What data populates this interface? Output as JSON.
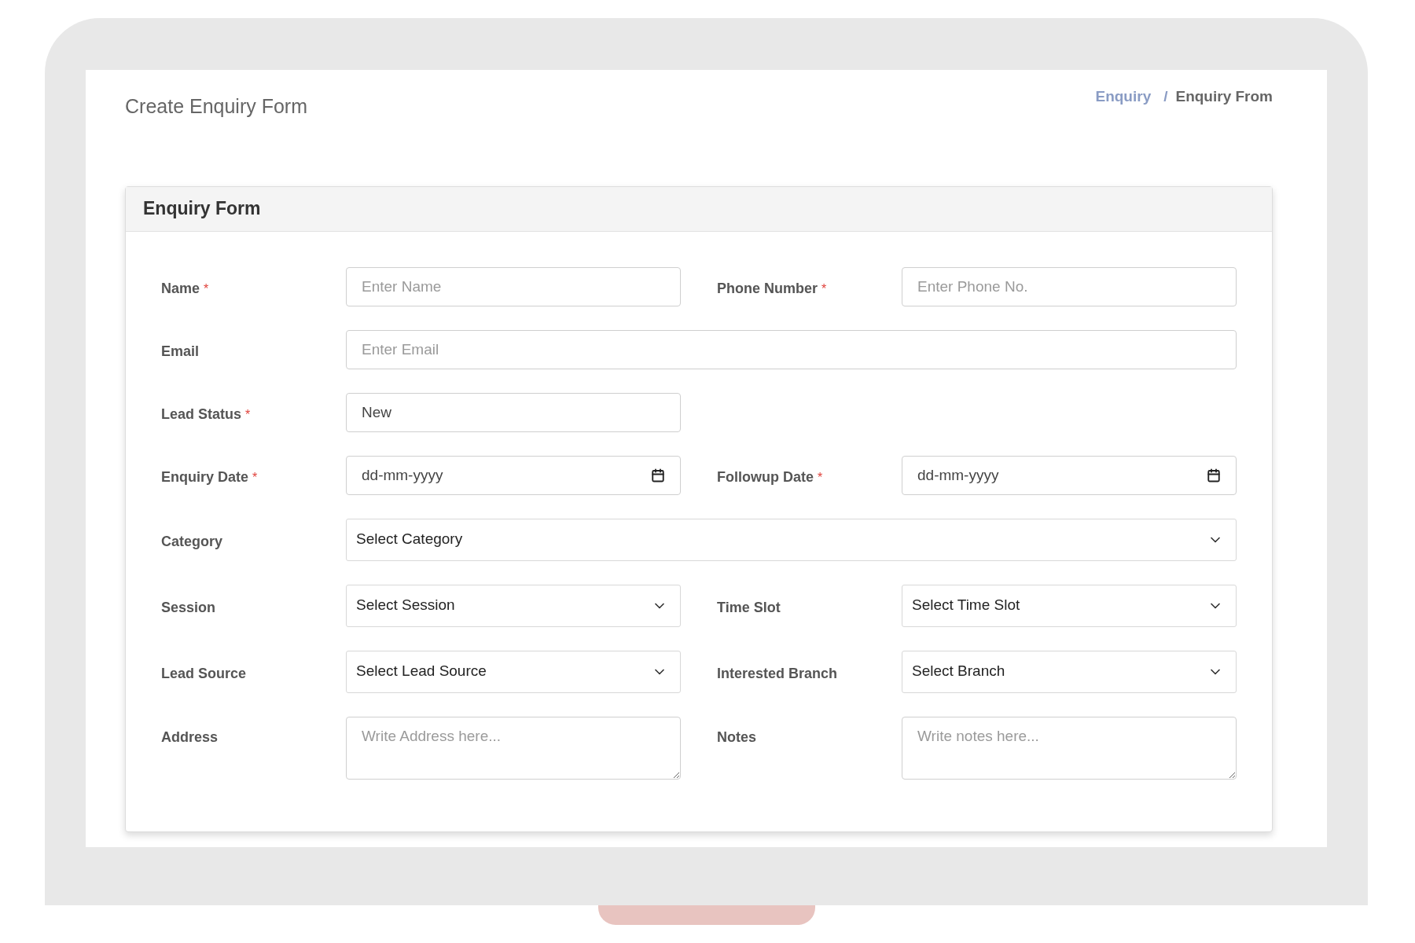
{
  "page_title": "Create Enquiry Form",
  "breadcrumb": [
    {
      "label": "Enquiry",
      "kind": "link"
    },
    {
      "separator": "/",
      "label": "Enquiry From",
      "kind": "current"
    }
  ],
  "card": {
    "title": "Enquiry Form",
    "rows": [
      [
        {
          "label": "Name",
          "required_mark": "*",
          "kind": "text",
          "wide": false,
          "placeholder": "Enter Name"
        },
        {
          "label": "Phone Number",
          "required_mark": "*",
          "kind": "text",
          "wide": false,
          "placeholder": "Enter Phone No."
        }
      ],
      [
        {
          "label": "Email",
          "kind": "text",
          "wide": true,
          "placeholder": "Enter Email"
        }
      ],
      [
        {
          "label": "Lead Status",
          "required_mark": "*",
          "kind": "text",
          "wide": false,
          "value": "New"
        }
      ],
      [
        {
          "label": "Enquiry Date",
          "required_mark": "*",
          "kind": "date",
          "wide": false,
          "placeholder": "dd-mm-yyyy"
        },
        {
          "label": "Followup Date",
          "required_mark": "*",
          "kind": "date",
          "wide": false,
          "placeholder": "dd-mm-yyyy"
        }
      ],
      [
        {
          "label": "Category",
          "kind": "select",
          "wide": true,
          "value": "Select Category"
        }
      ],
      [
        {
          "label": "Session",
          "kind": "select",
          "wide": false,
          "value": "Select Session"
        },
        {
          "label": "Time Slot",
          "kind": "select",
          "wide": false,
          "value": "Select Time Slot"
        }
      ],
      [
        {
          "label": "Lead Source",
          "kind": "select",
          "wide": false,
          "value": "Select Lead Source"
        },
        {
          "label": "Interested Branch",
          "kind": "select",
          "wide": false,
          "value": "Select Branch"
        }
      ],
      [
        {
          "label": "Address",
          "kind": "textarea",
          "wide": false,
          "placeholder": "Write Address here..."
        },
        {
          "label": "Notes",
          "kind": "textarea",
          "wide": false,
          "placeholder": "Write notes here..."
        }
      ]
    ]
  }
}
